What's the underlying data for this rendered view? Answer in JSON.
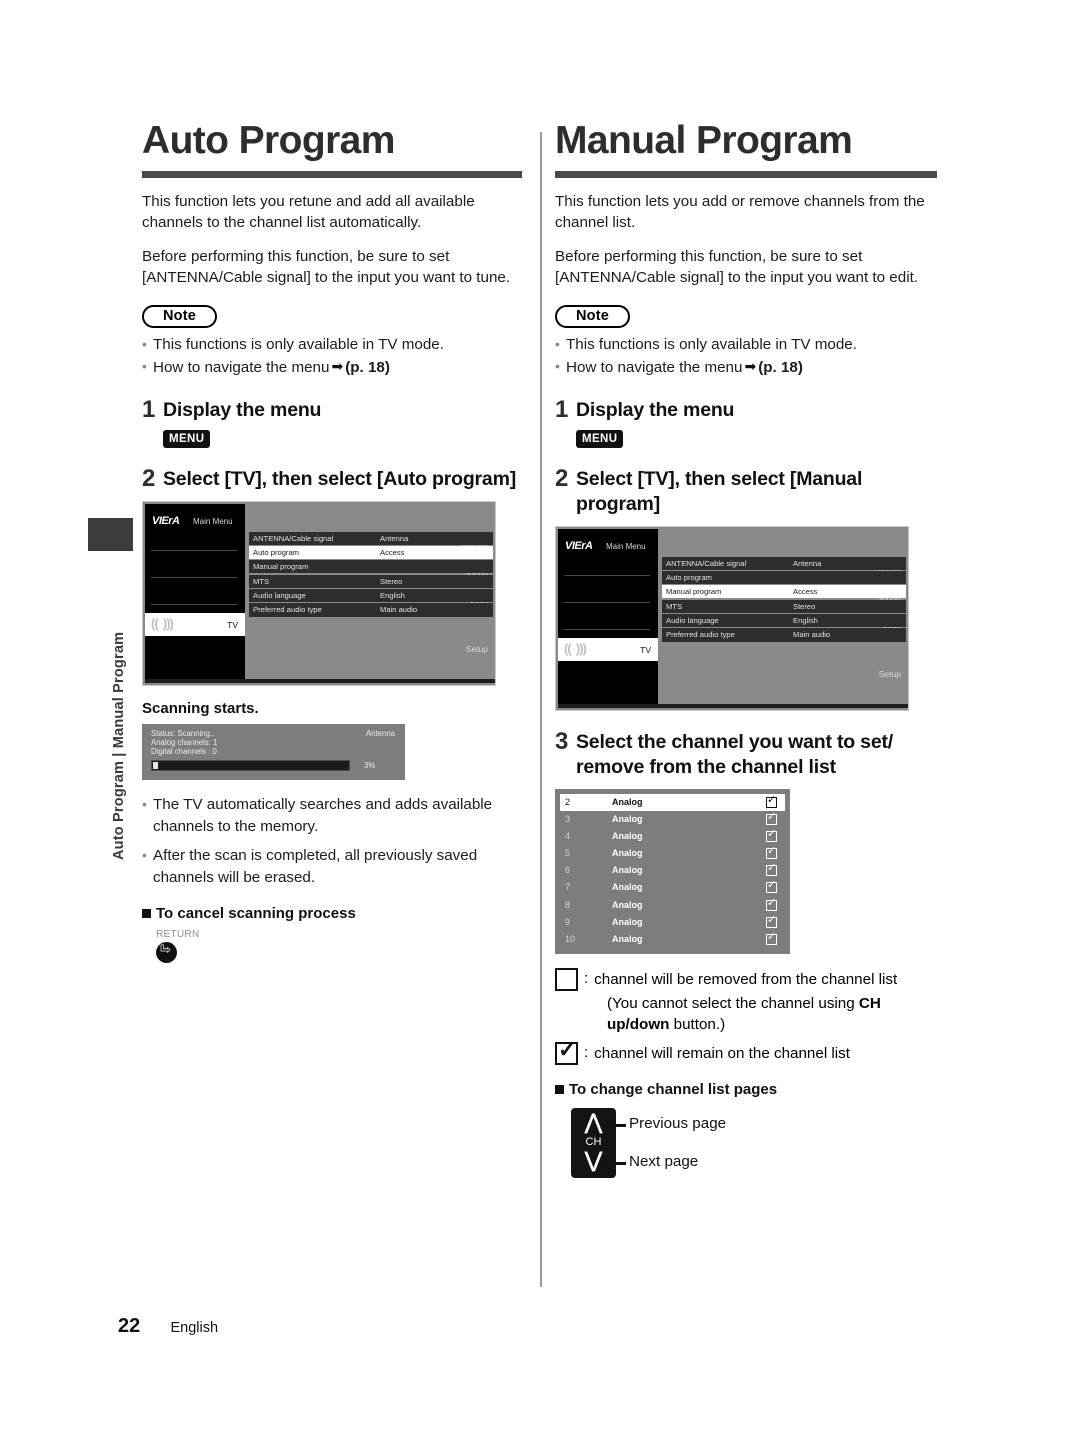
{
  "side_tab_text": "Auto Program | Manual Program",
  "footer": {
    "page_number": "22",
    "language": "English"
  },
  "left": {
    "title": "Auto Program",
    "intro1": "This function lets you retune and add all available channels to the channel list automatically.",
    "intro2": "Before performing this function, be sure to set [ANTENNA/Cable signal] to the input you want to tune.",
    "note_label": "Note",
    "notes": [
      "This functions is only available in TV mode.",
      "How to navigate the menu"
    ],
    "note_ref": "(p. 18)",
    "step1_num": "1",
    "step1_title": "Display the menu",
    "step1_key": "MENU",
    "step2_num": "2",
    "step2_title": "Select [TV], then select [Auto program]",
    "tvmenu": {
      "brand": "VIErA",
      "main_menu": "Main Menu",
      "nav": [
        "Picture",
        "Sound",
        "Lock",
        "TV",
        "Setup"
      ],
      "rows": [
        {
          "label": "ANTENNA/Cable signal",
          "value": "Antenna",
          "selected": false
        },
        {
          "label": "Auto program",
          "value": "Access",
          "selected": true
        },
        {
          "label": "Manual program",
          "value": "",
          "selected": false
        },
        {
          "label": "MTS",
          "value": "Stereo",
          "selected": false
        },
        {
          "label": "Audio language",
          "value": "English",
          "selected": false
        },
        {
          "label": "Preferred audio type",
          "value": "Main audio",
          "selected": false
        }
      ]
    },
    "scan_heading": "Scanning starts.",
    "scan": {
      "status": "Status: Scanning..",
      "analog": "Analog channels: 1",
      "digital": "Digital channels : 0",
      "source": "Antenna",
      "percent": "3%"
    },
    "bullets": [
      "The TV automatically searches and adds available channels to the memory.",
      "After the scan is completed, all previously saved channels will be erased."
    ],
    "cancel_heading": "To cancel scanning process",
    "return_label": "RETURN"
  },
  "right": {
    "title": "Manual Program",
    "intro1": "This function lets you add or remove channels from the channel list.",
    "intro2": "Before performing this function, be sure to set [ANTENNA/Cable signal] to the input you want to edit.",
    "note_label": "Note",
    "notes": [
      "This functions is only available in TV mode.",
      "How to navigate the menu"
    ],
    "note_ref": "(p. 18)",
    "step1_num": "1",
    "step1_title": "Display the menu",
    "step1_key": "MENU",
    "step2_num": "2",
    "step2_title": "Select [TV], then select [Manual program]",
    "tvmenu": {
      "brand": "VIErA",
      "main_menu": "Main Menu",
      "nav": [
        "Picture",
        "Sound",
        "Lock",
        "TV",
        "Setup"
      ],
      "rows": [
        {
          "label": "ANTENNA/Cable signal",
          "value": "Antenna",
          "selected": false
        },
        {
          "label": "Auto program",
          "value": "",
          "selected": false
        },
        {
          "label": "Manual program",
          "value": "Access",
          "selected": true
        },
        {
          "label": "MTS",
          "value": "Stereo",
          "selected": false
        },
        {
          "label": "Audio language",
          "value": "English",
          "selected": false
        },
        {
          "label": "Preferred audio type",
          "value": "Main audio",
          "selected": false
        }
      ]
    },
    "step3_num": "3",
    "step3_title": "Select the channel you want to set/ remove from the channel list",
    "channel_list": [
      {
        "num": "2",
        "name": "Analog",
        "checked": true,
        "selected": true
      },
      {
        "num": "3",
        "name": "Analog",
        "checked": true,
        "selected": false
      },
      {
        "num": "4",
        "name": "Analog",
        "checked": true,
        "selected": false
      },
      {
        "num": "5",
        "name": "Analog",
        "checked": true,
        "selected": false
      },
      {
        "num": "6",
        "name": "Analog",
        "checked": true,
        "selected": false
      },
      {
        "num": "7",
        "name": "Analog",
        "checked": true,
        "selected": false
      },
      {
        "num": "8",
        "name": "Analog",
        "checked": true,
        "selected": false
      },
      {
        "num": "9",
        "name": "Analog",
        "checked": true,
        "selected": false
      },
      {
        "num": "10",
        "name": "Analog",
        "checked": true,
        "selected": false
      }
    ],
    "legend_unchecked": "channel will be removed from the channel list",
    "legend_unchecked_sub_a": "(You cannot select the channel using ",
    "legend_unchecked_sub_b": "CH up/",
    "legend_unchecked_sub_c": "down",
    "legend_unchecked_sub_d": " button.)",
    "legend_checked": "channel will remain on the channel list",
    "pages_heading": "To change channel list pages",
    "ch_button_label": "CH",
    "ch_up_caption": "Previous page",
    "ch_down_caption": "Next page"
  }
}
